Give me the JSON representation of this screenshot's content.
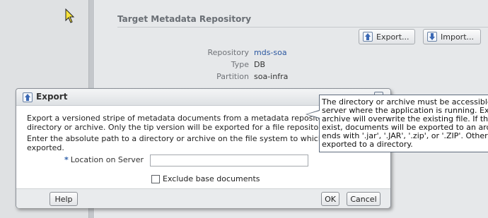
{
  "section": {
    "title": "Target Metadata Repository",
    "export_label": "Export...",
    "import_label": "Import..."
  },
  "properties": [
    {
      "label": "Repository",
      "value": "mds-soa"
    },
    {
      "label": "Type",
      "value": "DB"
    },
    {
      "label": "Partition",
      "value": "soa-infra"
    }
  ],
  "dialog": {
    "title": "Export",
    "desc_line1": "Export a versioned stripe of metadata documents from a metadata repository partition",
    "desc_line2": "directory or archive. Only the tip version will be exported for a file repository",
    "path_line1": "Enter the absolute path to a directory or archive on the file system to which the metad",
    "path_line2": "exported.",
    "required_marker": "*",
    "location_label": "Location on Server",
    "location_value": "",
    "exclude_label": "Exclude base documents",
    "help_label": "Help",
    "ok_label": "OK",
    "cancel_label": "Cancel"
  },
  "tooltip": {
    "lines": [
      "The directory or archive must be accessible from",
      "server where the application is running. Exporting",
      "archive will overwrite the existing file. If the locati",
      "exist, documents will be exported to an archive if",
      "ends with '.jar', '.JAR', '.zip', or '.ZIP'. Otherwise,",
      "exported to a directory."
    ]
  },
  "colors": {
    "link": "#2b57a0",
    "required": "#2f5fa8"
  }
}
